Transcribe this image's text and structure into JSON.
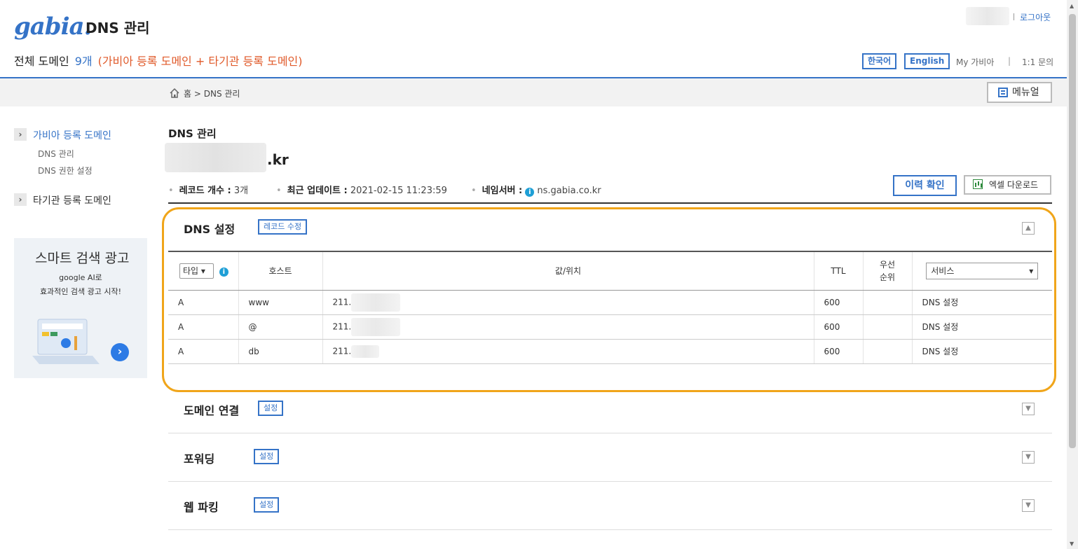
{
  "header": {
    "logo": "gabia.",
    "title": "DNS 관리",
    "logout": "로그아웃",
    "total_label": "전체 도메인",
    "total_count": "9개",
    "total_sub": "(가비아 등록 도메인 + 타기관 등록 도메인)",
    "lang_ko": "한국어",
    "lang_en": "English",
    "my_gabia": "My 가비아",
    "separator": "|",
    "inquiry": "1:1 문의"
  },
  "breadcrumb": {
    "text": "홈 > DNS 관리",
    "manual_label": "메뉴얼"
  },
  "sidebar": {
    "group1": {
      "label": "가비아 등록 도메인",
      "items": [
        "DNS 관리",
        "DNS 권한 설정"
      ]
    },
    "group2": {
      "label": "타기관 등록 도메인"
    },
    "ad": {
      "title": "스마트 검색 광고",
      "line1": "google AI로",
      "line2": "효과적인 검색 광고 시작!"
    }
  },
  "main": {
    "title": "DNS 관리",
    "domain_tld": ".kr",
    "record_count_label": "레코드 개수 :",
    "record_count": "3개",
    "updated_label": "최근 업데이트 :",
    "updated_value": "2021-02-15 11:23:59",
    "ns_label": "네임서버 :",
    "ns_value": "ns.gabia.co.kr",
    "history_button": "이력 확인",
    "excel_button": "엑셀 다운로드"
  },
  "dns_section": {
    "title": "DNS 설정",
    "edit_button": "레코드 수정",
    "columns": {
      "type": "타입",
      "host": "호스트",
      "value": "값/위치",
      "ttl": "TTL",
      "priority": "우선\n순위",
      "service": "서비스"
    },
    "rows": [
      {
        "type": "A",
        "host": "www",
        "value": "211.",
        "ttl": "600",
        "priority": "",
        "service": "DNS 설정"
      },
      {
        "type": "A",
        "host": "@",
        "value": "211.",
        "ttl": "600",
        "priority": "",
        "service": "DNS 설정"
      },
      {
        "type": "A",
        "host": "db",
        "value": "211.",
        "ttl": "600",
        "priority": "",
        "service": "DNS 설정"
      }
    ]
  },
  "sections": [
    {
      "title": "도메인 연결",
      "button": "설정"
    },
    {
      "title": "포워딩",
      "button": "설정"
    },
    {
      "title": "웹 파킹",
      "button": "설정"
    }
  ],
  "colors": {
    "accent": "#3573c7",
    "highlight": "#f0a51a",
    "subtitle": "#e05a2a"
  },
  "icons": [
    "home-icon",
    "manual-icon",
    "info-icon",
    "excel-icon",
    "chevron-up-icon",
    "chevron-down-icon",
    "chevron-right-icon"
  ]
}
